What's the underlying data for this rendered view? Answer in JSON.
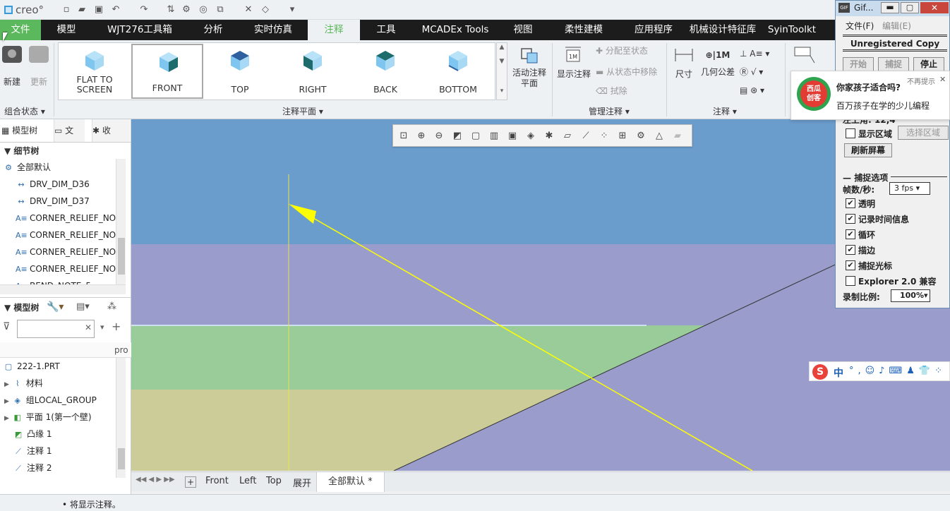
{
  "app": {
    "logo": "creo°"
  },
  "quick_access": {
    "icons": [
      "new-icon",
      "open-icon",
      "save-icon",
      "undo-icon",
      "redo-icon",
      "regenerate-icon",
      "settings-icon",
      "target-icon",
      "windows-icon",
      "close-window-icon",
      "display-style-icon",
      "more-icon"
    ]
  },
  "tabs": [
    {
      "label": "文件"
    },
    {
      "label": "模型"
    },
    {
      "label": "WJT276工具箱"
    },
    {
      "label": "分析"
    },
    {
      "label": "实时仿真"
    },
    {
      "label": "注释"
    },
    {
      "label": "工具"
    },
    {
      "label": "MCADEx Tools"
    },
    {
      "label": "视图"
    },
    {
      "label": "柔性建模"
    },
    {
      "label": "应用程序"
    },
    {
      "label": "机械设计特征库"
    },
    {
      "label": "SyinToolkt"
    }
  ],
  "ribbon": {
    "combined_state": {
      "new_label": "新建",
      "update_label": "更新",
      "group_label": "组合状态"
    },
    "annotation_planes": {
      "items": [
        {
          "label": "FLAT TO\nSCREEN",
          "color": "#7ec6ef"
        },
        {
          "label": "FRONT",
          "color": "#1e6b6b"
        },
        {
          "label": "TOP",
          "color": "#2e5f9e"
        },
        {
          "label": "RIGHT",
          "color": "#1e6b6b"
        },
        {
          "label": "BACK",
          "color": "#1e6b6b"
        },
        {
          "label": "BOTTOM",
          "color": "#7ec6ef"
        }
      ],
      "active_plane_label": "活动注释\n平面",
      "group_label": "注释平面"
    },
    "manage": {
      "show_label": "显示注释",
      "assign_label": "分配至状态",
      "remove_label": "从状态中移除",
      "erase_label": "拭除",
      "group_label": "管理注释"
    },
    "annotations": {
      "dimension_label": "尺寸",
      "gtol_label": "几何公差",
      "gtol_box": "1M",
      "group_label": "注释"
    }
  },
  "left_panel": {
    "tabs": [
      {
        "label": "模型树"
      },
      {
        "label": "文"
      },
      {
        "label": "收"
      }
    ],
    "detail_tree_label": "细节树",
    "detail_items": [
      "全部默认",
      "DRV_DIM_D36",
      "DRV_DIM_D37",
      "CORNER_RELIEF_NO",
      "CORNER_RELIEF_NO",
      "CORNER_RELIEF_NO",
      "CORNER_RELIEF_NO",
      "BEND_NOTE_5"
    ],
    "model_tree_label": "模型树",
    "search_placeholder": "",
    "column_header": "pro",
    "model_items": [
      "222-1.PRT",
      "材料",
      "组LOCAL_GROUP",
      "平面 1(第一个壁)",
      "凸缘 1",
      "注释 1",
      "注释 2"
    ]
  },
  "view_toolbar": {
    "icons": [
      "zoom-fit-icon",
      "zoom-in-icon",
      "zoom-out-icon",
      "repaint-icon",
      "display-style-icon",
      "saved-views-icon",
      "view-manager-icon",
      "perspective-icon",
      "datum-display-icon",
      "plane-display-icon",
      "axis-display-icon",
      "point-display-icon",
      "csys-display-icon",
      "annotation-display-icon",
      "spin-center-icon",
      "hidden-icon"
    ]
  },
  "canvas": {
    "bands": [
      "#6a9ccc",
      "#9a9ccc",
      "#99cc99",
      "#cccc99"
    ],
    "right_region": "#9a9ccc",
    "arrow_color": "#ffff00"
  },
  "bottom_tabs": [
    {
      "label": "Front"
    },
    {
      "label": "Left"
    },
    {
      "label": "Top"
    },
    {
      "label": "展开"
    },
    {
      "label": "全部默认 *"
    }
  ],
  "status": {
    "message": "将显示注释。"
  },
  "gif_recorder": {
    "title": "Gif...",
    "menu_file": "文件(F)",
    "menu_edit": "编辑(E)",
    "banner": "Unregistered Copy",
    "start_label": "开始",
    "capture_label": "捕捉",
    "stop_label": "停止",
    "top_left_label": "左上角:",
    "top_left_value": "12,4",
    "show_region_label": "显示区域",
    "select_region_label": "选择区域",
    "refresh_label": "刷新屏幕",
    "capture_options_label": "捕捉选项",
    "fps_label": "帧数/秒:",
    "fps_value": "3 fps",
    "options": [
      {
        "label": "透明",
        "checked": true
      },
      {
        "label": "记录时间信息",
        "checked": true
      },
      {
        "label": "循环",
        "checked": true
      },
      {
        "label": "描边",
        "checked": true
      },
      {
        "label": "捕捉光标",
        "checked": true
      },
      {
        "label": "Explorer 2.0 兼容",
        "checked": false
      }
    ],
    "scale_label": "录制比例:",
    "scale_value": "100%"
  },
  "notification": {
    "brand_line1": "西瓜",
    "brand_line2": "创客",
    "title": "你家孩子适合吗?",
    "body": "百万孩子在学的少儿编程",
    "dismiss_label": "不再提示",
    "close": "✕"
  },
  "ime_bar": {
    "label": "中"
  }
}
